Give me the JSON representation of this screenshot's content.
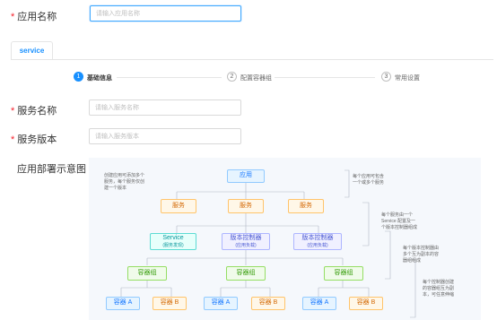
{
  "app_name_field": {
    "label": "应用名称",
    "required_mark": "*",
    "placeholder": "请输入应用名称"
  },
  "tabs": [
    {
      "label": "service"
    }
  ],
  "steps": [
    {
      "number": "1",
      "title": "基础信息"
    },
    {
      "number": "2",
      "title": "配置容器组"
    },
    {
      "number": "3",
      "title": "常用设置"
    }
  ],
  "service_name_field": {
    "label": "服务名称",
    "required_mark": "*",
    "placeholder": "请输入服务名称"
  },
  "service_version_field": {
    "label": "服务版本",
    "required_mark": "*",
    "placeholder": "请输入服务版本"
  },
  "diagram_label": "应用部署示意图",
  "diagram": {
    "app": "应用",
    "service": "服务",
    "service_node": {
      "title": "Service",
      "sub": "(服务发现)"
    },
    "version_controller": {
      "title": "版本控制器",
      "sub": "(应用负载)"
    },
    "container_group": "容器组",
    "container_a": "容器 A",
    "container_b": "容器 B",
    "note_top_left": [
      "创建应用可添加多个",
      "服务，每个服务仅创",
      "建一个版本"
    ],
    "note_app": [
      "每个应用可包含",
      "一个或多个服务"
    ],
    "note_service": [
      "每个服务由一个",
      "Service 配置及一",
      "个版本控制器组成"
    ],
    "note_controller": [
      "每个版本控制器由",
      "多个互为副本的容",
      "器组组成"
    ],
    "note_group": [
      "每个控制器创建",
      "的容器组互为副",
      "本，可任意伸缩"
    ]
  },
  "colors": {
    "primary": "#1890ff",
    "required": "#f5222d",
    "app_box": "#e6f4ff",
    "service_box": "#fff7e8",
    "service_discovery_box": "#e6fffb",
    "controller_box": "#f0f0ff",
    "group_box": "#f0fbea",
    "diagram_bg": "#f5f8fc"
  }
}
